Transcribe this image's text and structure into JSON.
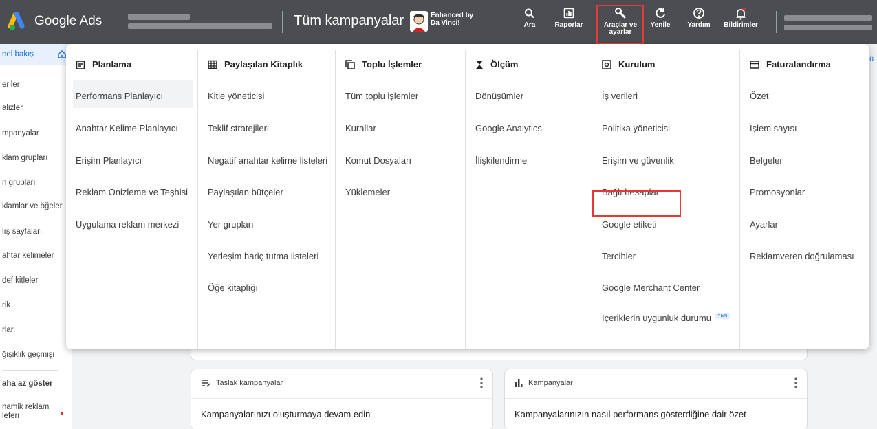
{
  "app": {
    "brand": "Google Ads",
    "page_title": "Tüm kampanyalar",
    "enhanced_text": "Enhanced by Da Vinci!"
  },
  "toolbar": [
    {
      "label": "Ara",
      "icon": "search-icon"
    },
    {
      "label": "Raporlar",
      "icon": "reports-icon"
    },
    {
      "label": "Araçlar ve ayarlar",
      "icon": "wrench-icon",
      "active": true
    },
    {
      "label": "Yenile",
      "icon": "refresh-icon"
    },
    {
      "label": "Yardım",
      "icon": "help-icon"
    },
    {
      "label": "Bildirimler",
      "icon": "bell-icon"
    }
  ],
  "sidebar": {
    "items": [
      "nel bakış",
      "eriler",
      "alizler",
      "mpanyalar",
      "klam grupları",
      "n grupları",
      "klamlar ve öğeler",
      "lış sayfaları",
      "ahtar kelimeler",
      "def kitleler",
      "rik",
      "rlar",
      "ğişiklik geçmişi",
      "aha az göster",
      "namik reklam",
      "leferi"
    ]
  },
  "menu": {
    "columns": [
      {
        "title": "Planlama",
        "icon": "planning-icon",
        "links": [
          "Performans Planlayıcı",
          "Anahtar Kelime Planlayıcı",
          "Erişim Planlayıcı",
          "Reklam Önizleme ve Teşhisi",
          "Uygulama reklam merkezi"
        ]
      },
      {
        "title": "Paylaşılan Kitaplık",
        "icon": "library-icon",
        "links": [
          "Kitle yöneticisi",
          "Teklif stratejileri",
          "Negatif anahtar kelime listeleri",
          "Paylaşılan bütçeler",
          "Yer grupları",
          "Yerleşim hariç tutma listeleri",
          "Öğe kitaplığı"
        ]
      },
      {
        "title": "Toplu İşlemler",
        "icon": "bulk-icon",
        "links": [
          "Tüm toplu işlemler",
          "Kurallar",
          "Komut Dosyaları",
          "Yüklemeler"
        ]
      },
      {
        "title": "Ölçüm",
        "icon": "hourglass-icon",
        "links": [
          "Dönüşümler",
          "Google Analytics",
          "İlişkilendirme"
        ]
      },
      {
        "title": "Kurulum",
        "icon": "setup-icon",
        "links": [
          "İş verileri",
          "Politika yöneticisi",
          "Erişim ve güvenlik",
          "Bağlı hesaplar",
          "Google etiketi",
          "Tercihler",
          "Google Merchant Center",
          "İçeriklerin uygunluk durumu"
        ],
        "new_badge": "YENİ"
      },
      {
        "title": "Faturalandırma",
        "icon": "billing-icon",
        "links": [
          "Özet",
          "İşlem sayısı",
          "Belgeler",
          "Promosyonlar",
          "Ayarlar",
          "Reklamveren doğrulaması"
        ]
      }
    ]
  },
  "cards": [
    {
      "title": "Taslak kampanyalar",
      "body": "Kampanyalarınızı oluşturmaya devam edin",
      "icon": "draft-icon"
    },
    {
      "title": "Kampanyalar",
      "body": "Kampanyalarınızın nasıl performans gösterdiğine dair özet",
      "icon": "bar-chart-icon"
    }
  ],
  "right_edge": "ü",
  "colors": {
    "topbar": "#4a4d51",
    "highlight": "#e53935",
    "accent": "#1a73e8"
  }
}
